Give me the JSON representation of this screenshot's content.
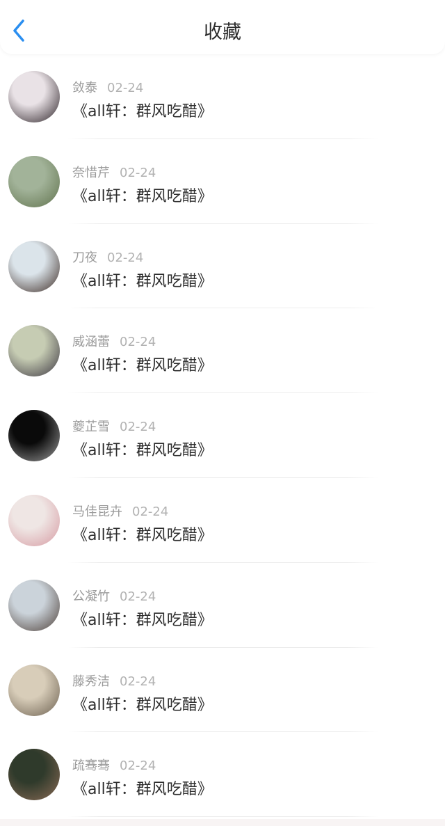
{
  "header": {
    "title": "收藏",
    "back_icon": "chevron-left-icon",
    "back_color": "#2a8ef0"
  },
  "items": [
    {
      "name": "敛泰",
      "date": "02-24",
      "title": "《all轩：群风吃醋》",
      "avatar_colors": [
        "#e9e2e6",
        "#2c2227"
      ]
    },
    {
      "name": "奈惜芹",
      "date": "02-24",
      "title": "《all轩：群风吃醋》",
      "avatar_colors": [
        "#a2b399",
        "#60724d"
      ]
    },
    {
      "name": "刀夜",
      "date": "02-24",
      "title": "《all轩：群风吃醋》",
      "avatar_colors": [
        "#dbe4ea",
        "#3d2b24"
      ]
    },
    {
      "name": "威涵蕾",
      "date": "02-24",
      "title": "《all轩：群风吃醋》",
      "avatar_colors": [
        "#c6ccb3",
        "#3b3640"
      ]
    },
    {
      "name": "夔芷雪",
      "date": "02-24",
      "title": "《all轩：群风吃醋》",
      "avatar_colors": [
        "#0a0a0a",
        "#9a9a9a"
      ]
    },
    {
      "name": "马佳昆卉",
      "date": "02-24",
      "title": "《all轩：群风吃醋》",
      "avatar_colors": [
        "#efe6e4",
        "#d69aa2"
      ]
    },
    {
      "name": "公凝竹",
      "date": "02-24",
      "title": "《all轩：群风吃醋》",
      "avatar_colors": [
        "#cbd3da",
        "#4d3f38"
      ]
    },
    {
      "name": "藤秀洁",
      "date": "02-24",
      "title": "《all轩：群风吃醋》",
      "avatar_colors": [
        "#d8cdb9",
        "#6b5f4f"
      ]
    },
    {
      "name": "疏骞骞",
      "date": "02-24",
      "title": "《all轩：群风吃醋》",
      "avatar_colors": [
        "#2f3a2b",
        "#8a6a55"
      ]
    }
  ]
}
